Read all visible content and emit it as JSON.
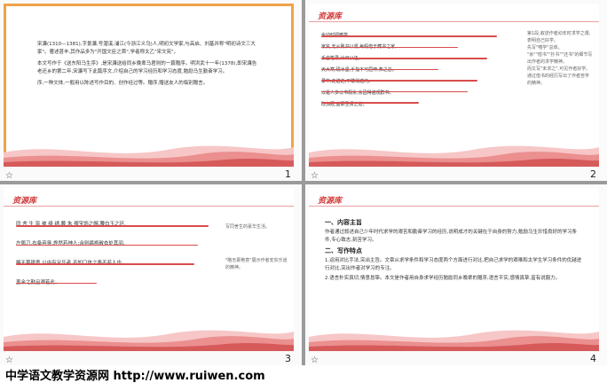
{
  "slides": [
    {
      "number": "1",
      "paragraphs": [
        "宋濂(1310—1381),字景濂,号潜溪,浦江(今浙江义乌)人,明初文学家,与高启、刘基并称\"明初诗文三大家\"。著述甚丰,其作品多为\"开国文臣之首\",学者称太乙\"宋文宪\"。",
        "本文写作于《送东阳马生序》,是宋濂送给同乡晚辈马君则的一篇赠序。明洪武十一年(1378),即宋濂告老还乡的第二年,宋濂写下此篇序文,介绍自己的学习经历和学习态度,勉励马生勤奋学习。",
        "序,一种文体,一般用以陈述写作目的、创作经过等。赠序,赠送友人的临别赠言。"
      ]
    },
    {
      "number": "2",
      "logo": "资源库",
      "lines": [
        "余幼时即嗜学。",
        "家贫,无从致书以观,每假借于藏书之家,",
        "手自笔录,计日以还。",
        "天大寒,砚冰坚,手指不可屈伸,弗之怠。",
        "录毕,走送之,不敢稍逾约。",
        "以是人多以书假余,余因得遍观群书。",
        "既加冠,益慕圣贤之道。"
      ],
      "side_notes": [
        "第1段,叙述作者幼年时求学之艰,表明自己好学。",
        "先写\"嗜学\"总体。",
        "\"余\"\"借书\"\"抄书\"\"还书\"的细节写出作者的求学精神。",
        "而又写\"未求之\",可见作者好学。",
        "通过借书的经历写出了作者苦学的精神。"
      ]
    },
    {
      "number": "3",
      "logo": "资源库",
      "lines": [
        "同 舍 生 皆 被 绮 绣,戴 朱 缨宝饰之帽,腰白玉之环,",
        "左佩刀,右备容臭,烨然若神人;余则缊袍敝衣处其间,",
        "略无慕艳意,以中有足乐者,不知口体之奉不若人也。",
        "盖余之勤且艰若此。"
      ],
      "side_notes": [
        "写同舍生的豪华生活。",
        "\"略无慕艳意\"展示作者安贫乐道的精神。"
      ]
    },
    {
      "number": "4",
      "logo": "资源库",
      "heading": "一、内容主旨",
      "paragraphs": [
        "作者通过叙述自己少年时代求学的艰苦和勤奋学习的经历,说明成才的关键在于自身的努力,勉励马生珍惜良好的学习条件,专心致志,刻苦学习。",
        "二、写作特点",
        "1.运用对比手法,突出主旨。文章从求学条件和学习态度两个方面进行对比,把自己求学的艰难和太学生学习条件的优越进行对比,突出作者对学习的专注。",
        "2.语言朴实真切,情意恳挚。本文是作者用自身求学经历勉励同乡晚辈的赠序,语言平实,感情真挚,富有说服力。"
      ]
    }
  ],
  "footer": "中学语文教学资源网 http://www.ruiwen.com"
}
